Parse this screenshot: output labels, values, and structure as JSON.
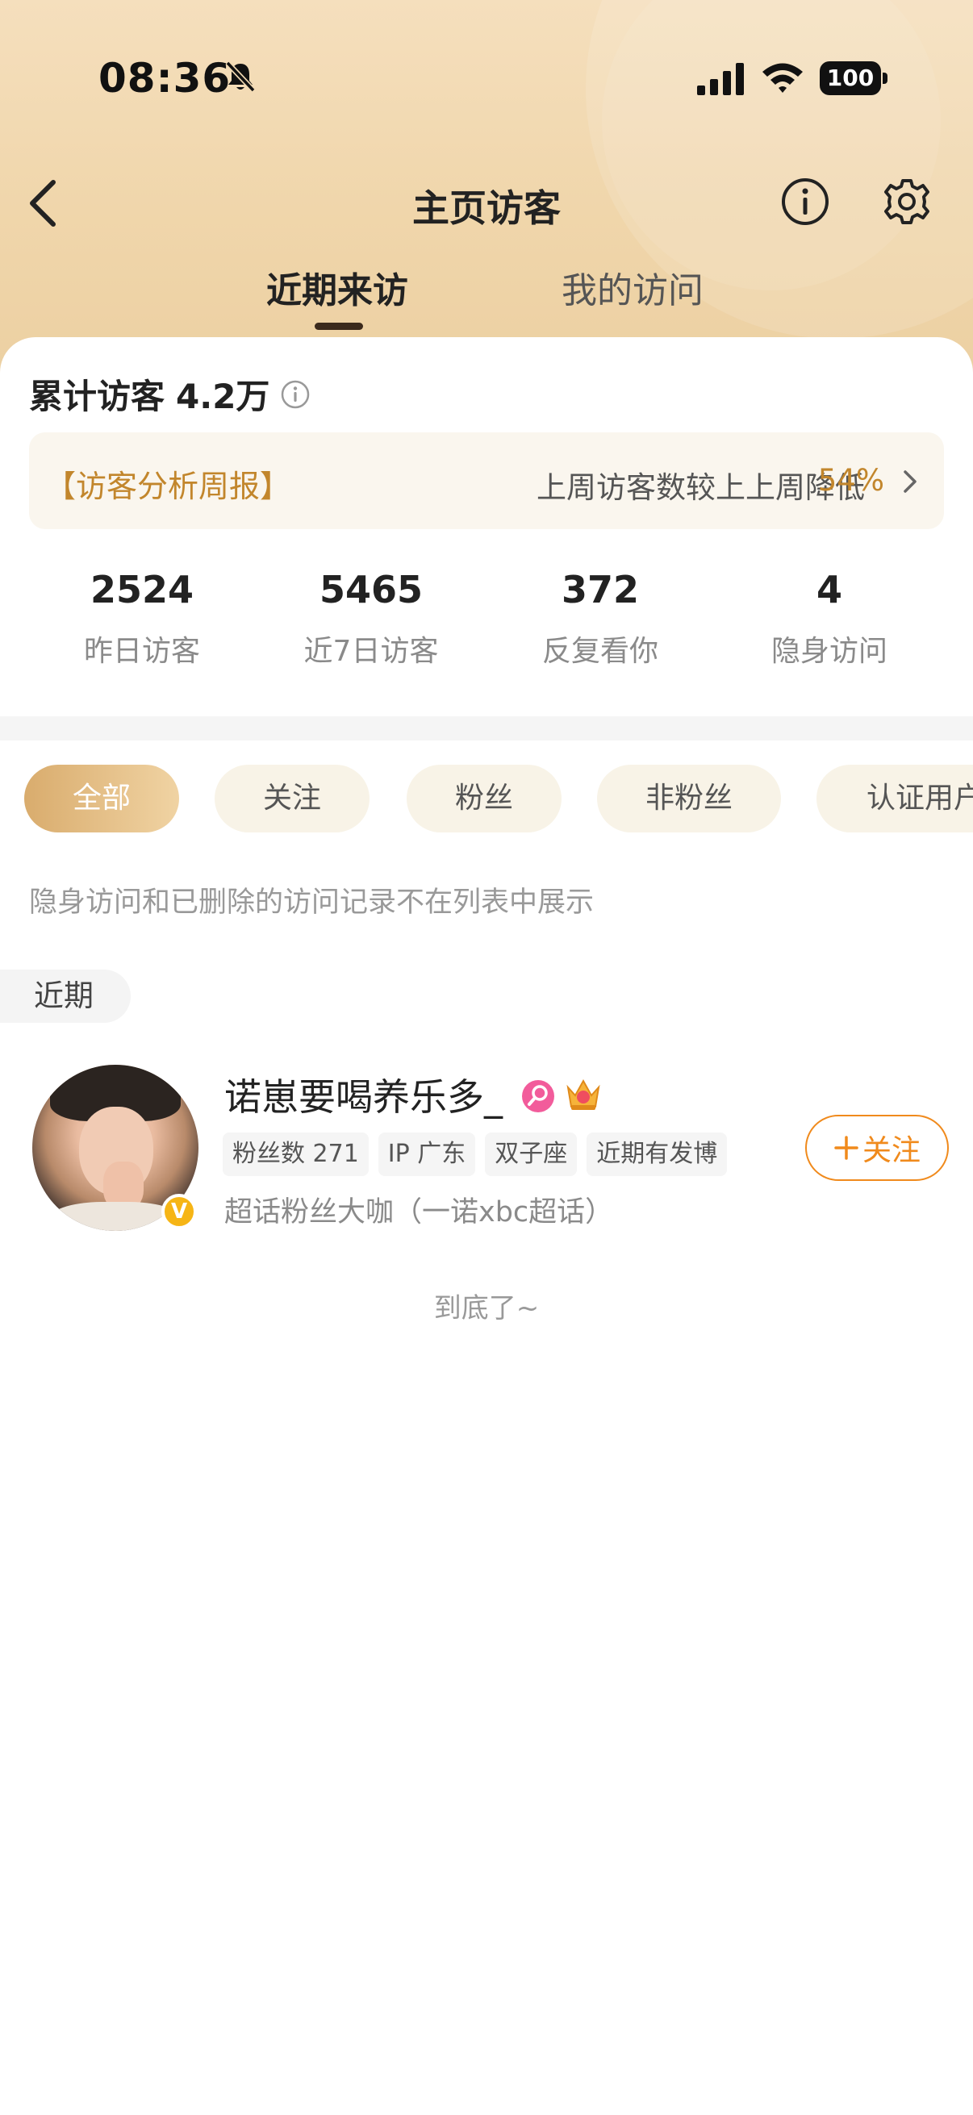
{
  "status_bar": {
    "time": "08:36",
    "battery": "100"
  },
  "nav": {
    "title": "主页访客"
  },
  "tabs": [
    {
      "label": "近期来访",
      "active": true
    },
    {
      "label": "我的访问",
      "active": false
    }
  ],
  "summary": {
    "total_label": "累计访客",
    "total_value": "4.2万",
    "report_label": "【访客分析周报】",
    "report_text": "上周访客数较上上周降低",
    "report_pct": "54%"
  },
  "stats": [
    {
      "value": "2524",
      "label": "昨日访客"
    },
    {
      "value": "5465",
      "label": "近7日访客"
    },
    {
      "value": "372",
      "label": "反复看你"
    },
    {
      "value": "4",
      "label": "隐身访问"
    }
  ],
  "filters": [
    {
      "label": "全部",
      "active": true
    },
    {
      "label": "关注",
      "active": false
    },
    {
      "label": "粉丝",
      "active": false
    },
    {
      "label": "非粉丝",
      "active": false
    },
    {
      "label": "认证用户",
      "active": false
    }
  ],
  "notice": "隐身访问和已删除的访问记录不在列表中展示",
  "section_label": "近期",
  "visitor": {
    "name": "诺崽要喝养乐多_",
    "verified_mark": "V",
    "tags": [
      "粉丝数 271",
      "IP 广东",
      "双子座",
      "近期有发博"
    ],
    "desc": "超话粉丝大咖（一诺xbc超话）",
    "follow_label": "关注"
  },
  "end_text": "到底了~",
  "colors": {
    "accent_gold": "#c2862c",
    "follow_orange": "#f08a1c",
    "chip_active_start": "#d9ac6d",
    "chip_bg": "#f8f3e7"
  }
}
